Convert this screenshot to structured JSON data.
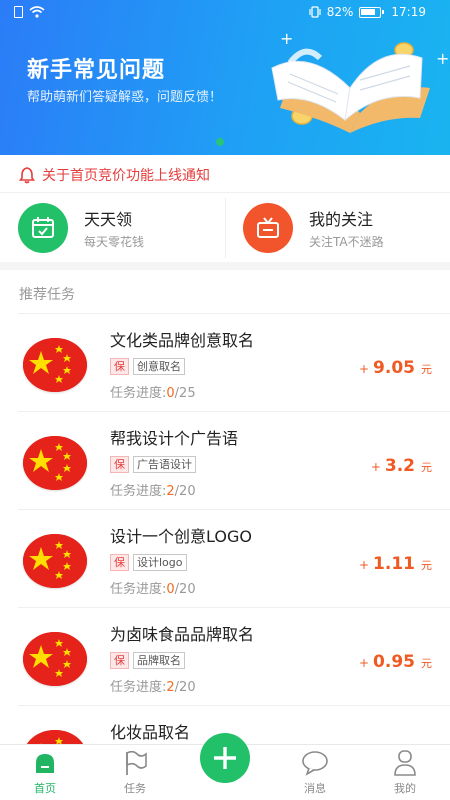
{
  "status_bar": {
    "battery": "82%",
    "time": "17:19"
  },
  "banner": {
    "title": "新手常见问题",
    "subtitle": "帮助萌新们答疑解惑，问题反馈！",
    "accent": "#2b7cf7"
  },
  "notice": {
    "text": "关于首页竞价功能上线通知",
    "icon": "bell-icon",
    "color": "#e53e3e"
  },
  "quick_entries": [
    {
      "title": "天天领",
      "subtitle": "每天零花钱",
      "icon": "calendar-icon",
      "color": "#21c069"
    },
    {
      "title": "我的关注",
      "subtitle": "关注TA不迷路",
      "icon": "tv-icon",
      "color": "#f2552b"
    }
  ],
  "section": {
    "label": "推荐任务"
  },
  "tasks": [
    {
      "title": "文化类品牌创意取名",
      "guarantee": "保",
      "category": "创意取名",
      "progress_label": "任务进度:",
      "progress_current": "0",
      "progress_total": "/25",
      "plus": "+",
      "amount": "9.05",
      "unit": "元"
    },
    {
      "title": "帮我设计个广告语",
      "guarantee": "保",
      "category": "广告语设计",
      "progress_label": "任务进度:",
      "progress_current": "2",
      "progress_total": "/20",
      "plus": "+",
      "amount": "3.2",
      "unit": "元"
    },
    {
      "title": "设计一个创意LOGO",
      "guarantee": "保",
      "category": "设计logo",
      "progress_label": "任务进度:",
      "progress_current": "0",
      "progress_total": "/20",
      "plus": "+",
      "amount": "1.11",
      "unit": "元"
    },
    {
      "title": "为卤味食品品牌取名",
      "guarantee": "保",
      "category": "品牌取名",
      "progress_label": "任务进度:",
      "progress_current": "2",
      "progress_total": "/20",
      "plus": "+",
      "amount": "0.95",
      "unit": "元"
    },
    {
      "title": "化妆品取名"
    }
  ],
  "bottom_nav": {
    "items": [
      {
        "label": "首页",
        "icon": "home-icon",
        "active": true
      },
      {
        "label": "任务",
        "icon": "flag-icon"
      },
      {
        "label": "",
        "icon": "plus-icon"
      },
      {
        "label": "消息",
        "icon": "message-icon"
      },
      {
        "label": "我的",
        "icon": "user-icon"
      }
    ],
    "active_color": "#21b563"
  }
}
